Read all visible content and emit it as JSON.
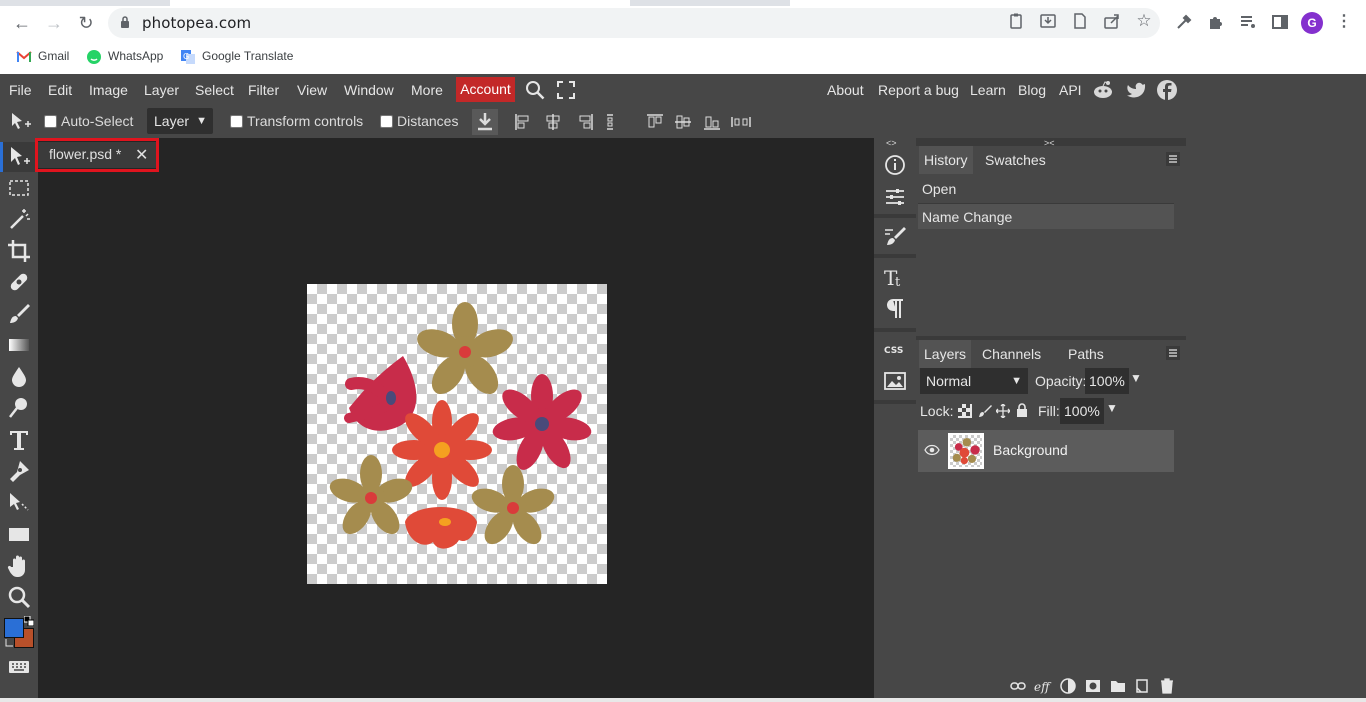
{
  "browser": {
    "url": "photopea.com",
    "profile_initial": "G",
    "bookmarks": [
      {
        "label": "Gmail"
      },
      {
        "label": "WhatsApp"
      },
      {
        "label": "Google Translate"
      }
    ]
  },
  "menubar": {
    "items": [
      "File",
      "Edit",
      "Image",
      "Layer",
      "Select",
      "Filter",
      "View",
      "Window",
      "More"
    ],
    "account_label": "Account",
    "right_links": [
      "About",
      "Report a bug",
      "Learn",
      "Blog",
      "API"
    ]
  },
  "options": {
    "auto_select_label": "Auto-Select",
    "auto_select_checked": false,
    "layer_select_value": "Layer",
    "transform_controls_label": "Transform controls",
    "distances_label": "Distances"
  },
  "document": {
    "tab_name": "flower.psd *"
  },
  "history": {
    "tabs": [
      "History",
      "Swatches"
    ],
    "entries": [
      "Open",
      "Name Change"
    ]
  },
  "layers": {
    "tabs": [
      "Layers",
      "Channels",
      "Paths"
    ],
    "blend_mode": "Normal",
    "opacity_label": "Opacity:",
    "opacity_value": "100%",
    "lock_label": "Lock:",
    "fill_label": "Fill:",
    "fill_value": "100%",
    "items": [
      {
        "name": "Background"
      }
    ]
  },
  "colors": {
    "accent_red": "#c32828",
    "highlight_red": "#e0141e",
    "foreground_color": "#2a6fd6",
    "background_color": "#b8502a"
  }
}
